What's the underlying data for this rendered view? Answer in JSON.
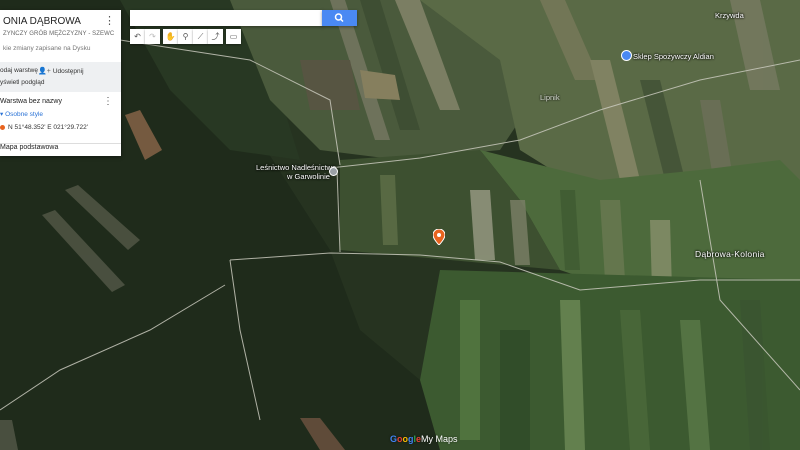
{
  "panel": {
    "title": "ONIA DĄBROWA",
    "subtitle": "ZYNCZY GRÓB MĘŻCZYZNY - SZEWC",
    "saved": "kie zmiany zapisane na Dysku",
    "add_layer": "odaj warstwę",
    "share": "Udostępnij",
    "preview": "yświetl podgląd",
    "layer_name": "Warstwa bez nazwy",
    "styles": "Osobne style",
    "pin_coords": "N 51°48.352' E 021°29.722'",
    "base_map": "Mapa podstawowa"
  },
  "search": {
    "placeholder": ""
  },
  "toolbar": {
    "undo": "undo-icon",
    "redo": "redo-icon",
    "pan": "hand-icon",
    "marker": "marker-icon",
    "line": "draw-line-icon",
    "route": "route-icon",
    "measure": "ruler-icon"
  },
  "map_labels": {
    "kozlow": "Krzywda",
    "shop": "Sklep Spożywczy Aldian",
    "village": "Lipnik",
    "forestry_line1": "Leśnictwo  Nadleśnictwo",
    "forestry_line2": "w Garwolinie",
    "dabrowa": "Dąbrowa-Kolonia"
  },
  "logo": {
    "g": "G",
    "o1": "o",
    "o2": "o",
    "gg": "g",
    "l": "l",
    "e": "e",
    "mymaps": "My Maps"
  },
  "colors": {
    "search_blue": "#4a89f3",
    "pin_orange": "#e8631e",
    "shop_blue": "#4a89f3"
  }
}
